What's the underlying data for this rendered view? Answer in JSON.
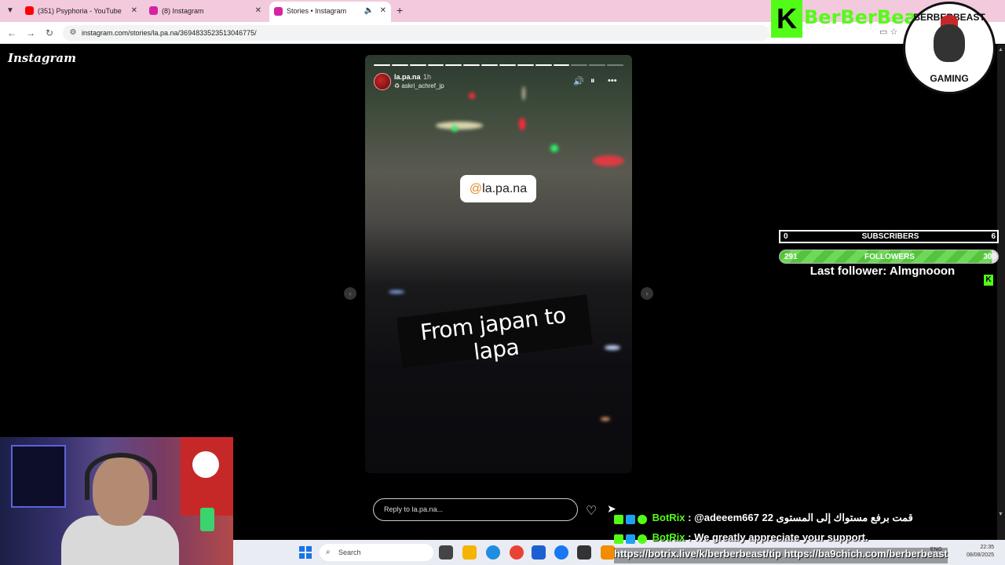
{
  "browser": {
    "tabs": [
      {
        "title": "(351) Psyphoria - YouTube",
        "icon": "youtube-icon",
        "color": "#ff0000"
      },
      {
        "title": "(8) Instagram",
        "icon": "instagram-icon",
        "color": "#d6249f"
      },
      {
        "title": "Stories • Instagram",
        "icon": "instagram-icon",
        "color": "#d6249f"
      }
    ],
    "url": "instagram.com/stories/la.pa.na/3694833523513046775/"
  },
  "instagram": {
    "logo": "Instagram",
    "story": {
      "username": "la.pa.na",
      "time": "1h",
      "subline": "askri_achref_jp",
      "mention": "la.pa.na",
      "mention_at": "@",
      "caption": "From japan to lapa",
      "segments_total": 14,
      "segments_done": 11
    },
    "reply_placeholder": "Reply to la.pa.na..."
  },
  "overlay": {
    "brand_letter": "K",
    "brand_name": "BerBerBeast",
    "badge_top": "BERBERBEAST",
    "badge_bottom": "GAMING",
    "subscribers": {
      "label": "SUBSCRIBERS",
      "current": "0",
      "goal": "6"
    },
    "followers": {
      "label": "FOLLOWERS",
      "current": "291",
      "goal": "300",
      "progress": 0.97
    },
    "last_follower": "Last follower: Almgnooon",
    "kick_color": "#53fc18",
    "chat": [
      {
        "user": "BotRix",
        "message": " : @adeeem667 قمت برفع مستواك إلى المستوى 22"
      },
      {
        "user": "BotRix",
        "message": " : We greatly appreciate your support."
      },
      {
        "user": "",
        "message": "https://botrix.live/k/berberbeast/tip https://ba9chich.com/berberbeast"
      }
    ]
  },
  "taskbar": {
    "search_placeholder": "Search",
    "lang": "ENG",
    "time": "22:35",
    "date": "08/08/2025"
  }
}
